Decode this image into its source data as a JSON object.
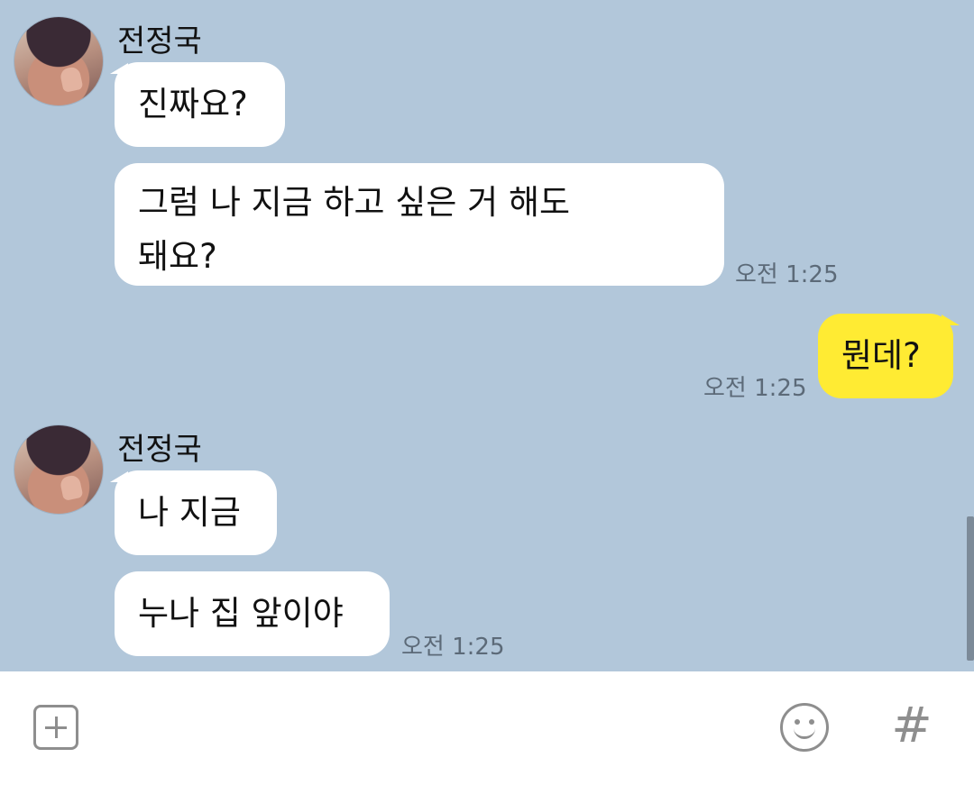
{
  "messages": {
    "group1": {
      "sender": "전정국",
      "bubble1": "진짜요?",
      "bubble2_line1": "그럼 나 지금 하고 싶은 거 해도",
      "bubble2_line2": "돼요?",
      "time": "오전 1:25"
    },
    "mine": {
      "text": "뭔데?",
      "time": "오전 1:25"
    },
    "group2": {
      "sender": "전정국",
      "bubble1": "나 지금",
      "bubble2": "누나 집 앞이야",
      "time": "오전 1:25"
    }
  },
  "input_bar": {
    "hash_label": "#",
    "icons": [
      "plus-icon",
      "emoji-icon",
      "hash-icon"
    ]
  },
  "colors": {
    "chat_background": "#b2c7da",
    "my_bubble": "#ffeb33",
    "other_bubble": "#ffffff"
  }
}
